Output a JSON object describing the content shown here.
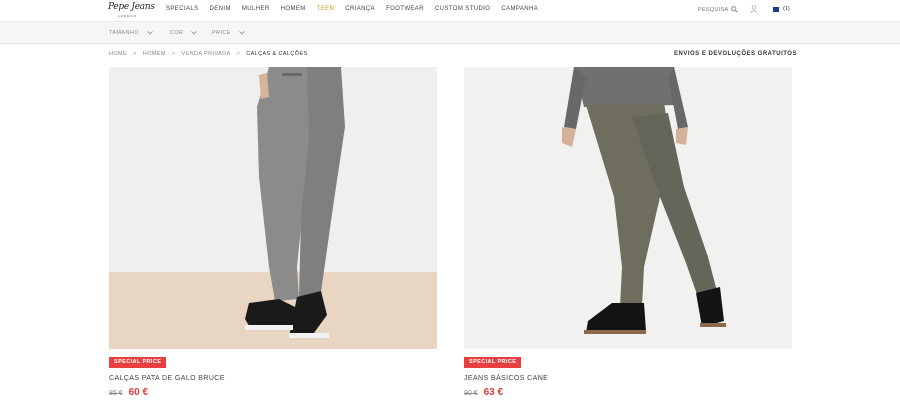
{
  "brand": {
    "name": "Pepe Jeans",
    "sub": "LONDON"
  },
  "nav": {
    "items": [
      "SPECIALS",
      "DENIM",
      "MULHER",
      "HOMEM",
      "TEEN",
      "CRIANÇA",
      "FOOTWEAR",
      "CUSTOM STUDIO",
      "CAMPANHA"
    ],
    "search_label": "PESQUISA",
    "cart_count": "(1)"
  },
  "filters": [
    "TAMANHO",
    "COR",
    "PRICE"
  ],
  "breadcrumb": [
    "HOME",
    "HOMEM",
    "VENDA PRIVADA",
    "CALÇAS & CALÇÕES"
  ],
  "shipping_label": "ENVIOS E DEVOLUÇÕES GRATUITOS",
  "products": [
    {
      "badge": "SPECIAL PRICE",
      "name": "CALÇAS PATA DE GALO BRUCE",
      "old_price": "85 €",
      "new_price": "60 €"
    },
    {
      "badge": "SPECIAL PRICE",
      "name": "JEANS BÁSICOS CANE",
      "old_price": "90 €",
      "new_price": "63 €"
    }
  ],
  "colors": {
    "sale": "#e84040",
    "teen": "#c8a100",
    "flag": "#1b3a8c"
  },
  "icons": [
    "search-icon",
    "user-icon",
    "cart-flag-icon",
    "chevron-down-icon"
  ]
}
